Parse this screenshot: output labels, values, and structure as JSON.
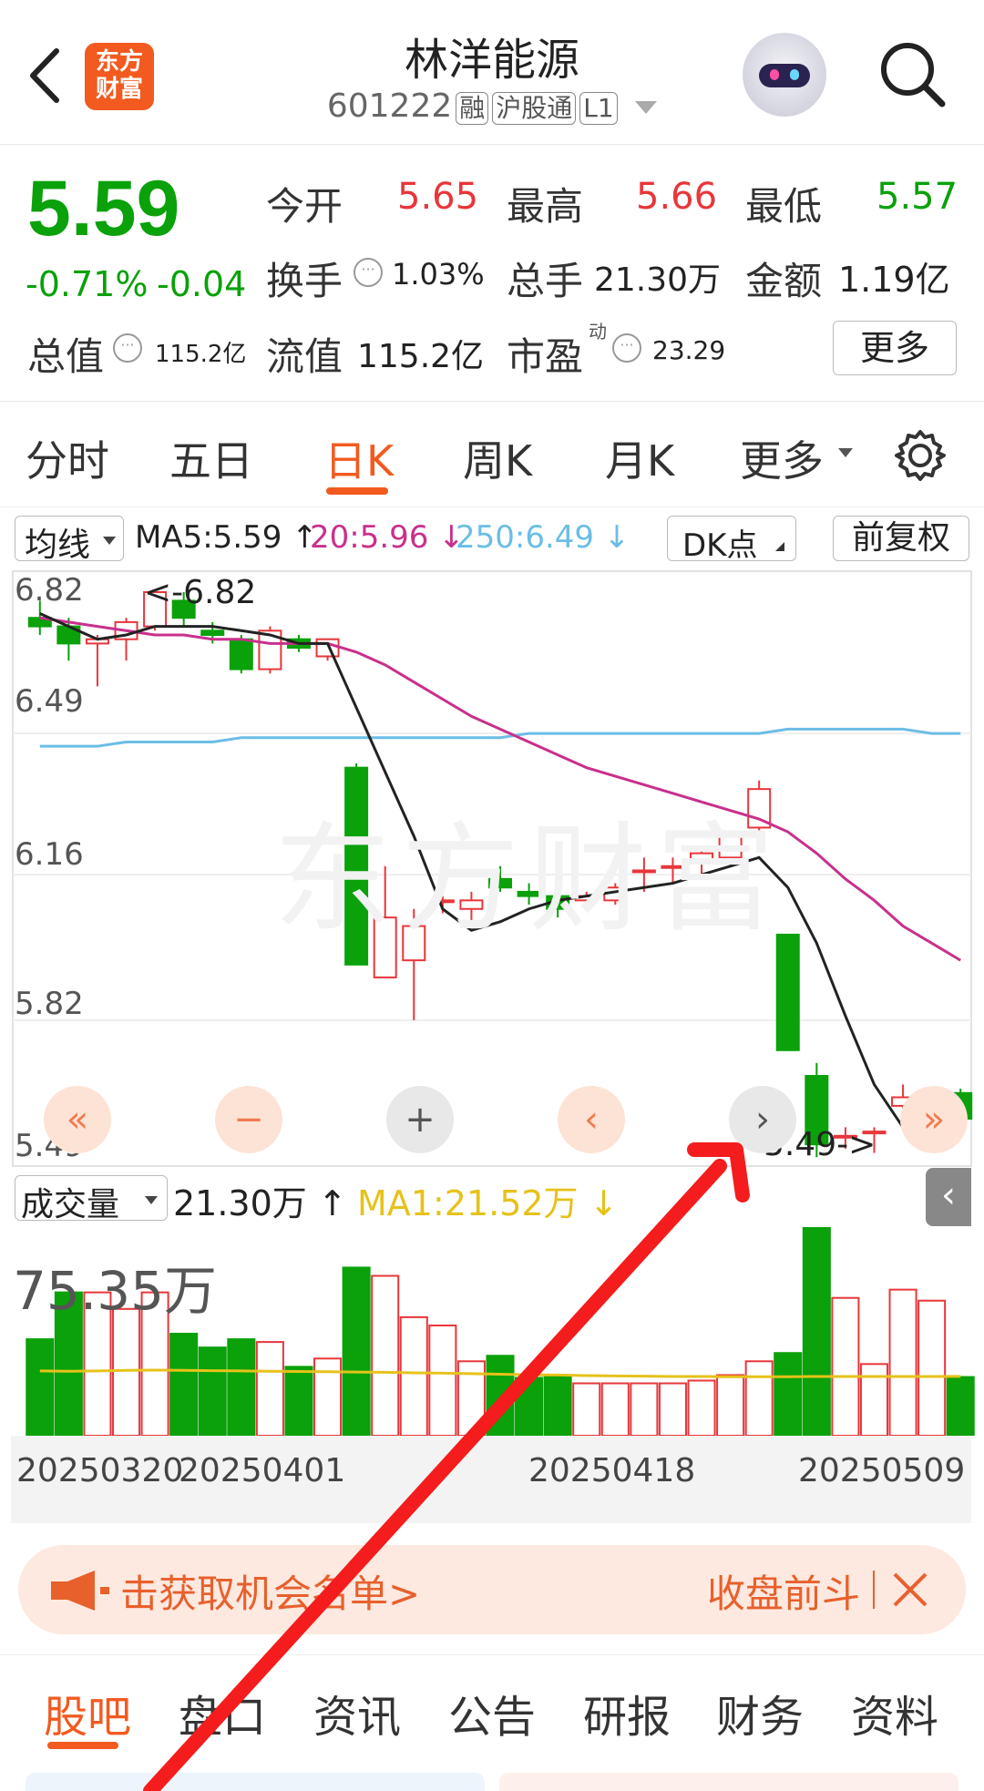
{
  "header": {
    "title": "林洋能源",
    "code": "601222",
    "tags": [
      "融",
      "沪股通",
      "L1"
    ],
    "logo_text": "东方财富"
  },
  "quote": {
    "price": "5.59",
    "change_pct": "-0.71%",
    "change": "-0.04",
    "open_label": "今开",
    "open": "5.65",
    "high_label": "最高",
    "high": "5.66",
    "low_label": "最低",
    "low": "5.57",
    "turnover_label": "换手",
    "turnover": "1.03%",
    "volume_label": "总手",
    "volume": "21.30万",
    "amount_label": "金额",
    "amount": "1.19亿",
    "mktcap_label": "总值",
    "mktcap": "115.2亿",
    "float_label": "流值",
    "float_cap": "115.2亿",
    "pe_label": "市盈",
    "pe_sup": "动",
    "pe": "23.29",
    "more_label": "更多"
  },
  "period_tabs": [
    "分时",
    "五日",
    "日K",
    "周K",
    "月K",
    "更多"
  ],
  "active_tab": "日K",
  "indicator_bar": {
    "selector": "均线",
    "ma5": "MA5:5.59",
    "ma20": "20:5.96",
    "ma250": "250:6.49",
    "dk": "DK点",
    "adjust": "前复权"
  },
  "price_axis": [
    "6.82",
    "6.49",
    "6.16",
    "5.82",
    "5.49"
  ],
  "annotations": {
    "high_marker": "<-6.82",
    "low_marker": "5.49->"
  },
  "volume_bar": {
    "selector": "成交量",
    "value": "21.30万",
    "ma1": "MA1:21.52万",
    "max_label": "75.35万"
  },
  "date_axis": [
    "20250320",
    "20250401",
    "20250418",
    "20250509"
  ],
  "banner": {
    "text": "击获取机会名单>",
    "right_text": "收盘前斗"
  },
  "bottom_tabs": [
    "股吧",
    "盘口",
    "资讯",
    "公告",
    "研报",
    "财务",
    "资料"
  ],
  "colors": {
    "up": "#e8363a",
    "down": "#0aa10a",
    "accent": "#f25a20",
    "ma5": "#222222",
    "ma20": "#c8308c",
    "ma250": "#6bbde6",
    "vol_ma": "#e6c21a"
  },
  "chart_data": {
    "type": "candlestick",
    "ylim": [
      5.49,
      6.82
    ],
    "candles": [
      {
        "o": 6.76,
        "h": 6.8,
        "l": 6.72,
        "c": 6.74
      },
      {
        "o": 6.74,
        "h": 6.76,
        "l": 6.66,
        "c": 6.7
      },
      {
        "o": 6.7,
        "h": 6.72,
        "l": 6.6,
        "c": 6.71
      },
      {
        "o": 6.71,
        "h": 6.76,
        "l": 6.66,
        "c": 6.75
      },
      {
        "o": 6.74,
        "h": 6.82,
        "l": 6.73,
        "c": 6.82
      },
      {
        "o": 6.8,
        "h": 6.82,
        "l": 6.74,
        "c": 6.76
      },
      {
        "o": 6.73,
        "h": 6.75,
        "l": 6.7,
        "c": 6.72
      },
      {
        "o": 6.71,
        "h": 6.72,
        "l": 6.63,
        "c": 6.64
      },
      {
        "o": 6.64,
        "h": 6.74,
        "l": 6.63,
        "c": 6.73
      },
      {
        "o": 6.71,
        "h": 6.72,
        "l": 6.68,
        "c": 6.69
      },
      {
        "o": 6.67,
        "h": 6.71,
        "l": 6.66,
        "c": 6.71
      },
      {
        "o": 6.41,
        "h": 6.42,
        "l": 5.95,
        "c": 5.95
      },
      {
        "o": 5.92,
        "h": 6.18,
        "l": 5.92,
        "c": 6.06
      },
      {
        "o": 5.96,
        "h": 6.08,
        "l": 5.82,
        "c": 6.04
      },
      {
        "o": 6.1,
        "h": 6.11,
        "l": 6.07,
        "c": 6.1
      },
      {
        "o": 6.08,
        "h": 6.12,
        "l": 6.05,
        "c": 6.1
      },
      {
        "o": 6.15,
        "h": 6.18,
        "l": 6.12,
        "c": 6.13
      },
      {
        "o": 6.12,
        "h": 6.14,
        "l": 6.09,
        "c": 6.11
      },
      {
        "o": 6.11,
        "h": 6.12,
        "l": 6.06,
        "c": 6.08
      },
      {
        "o": 6.1,
        "h": 6.12,
        "l": 6.08,
        "c": 6.11
      },
      {
        "o": 6.1,
        "h": 6.14,
        "l": 6.09,
        "c": 6.13
      },
      {
        "o": 6.17,
        "h": 6.2,
        "l": 6.12,
        "c": 6.17
      },
      {
        "o": 6.18,
        "h": 6.2,
        "l": 6.14,
        "c": 6.18
      },
      {
        "o": 6.19,
        "h": 6.22,
        "l": 6.16,
        "c": 6.21
      },
      {
        "o": 6.2,
        "h": 6.25,
        "l": 6.18,
        "c": 6.25
      },
      {
        "o": 6.27,
        "h": 6.38,
        "l": 6.26,
        "c": 6.36
      },
      {
        "o": 6.02,
        "h": 6.02,
        "l": 5.75,
        "c": 5.75
      },
      {
        "o": 5.69,
        "h": 5.72,
        "l": 5.5,
        "c": 5.53
      },
      {
        "o": 5.55,
        "h": 5.57,
        "l": 5.52,
        "c": 5.55
      },
      {
        "o": 5.56,
        "h": 5.57,
        "l": 5.51,
        "c": 5.56
      },
      {
        "o": 5.62,
        "h": 5.67,
        "l": 5.61,
        "c": 5.64
      },
      {
        "o": 5.63,
        "h": 5.66,
        "l": 5.58,
        "c": 5.65
      },
      {
        "o": 5.65,
        "h": 5.66,
        "l": 5.57,
        "c": 5.59
      }
    ],
    "ma5": [
      6.77,
      6.74,
      6.71,
      6.72,
      6.74,
      6.74,
      6.74,
      6.73,
      6.72,
      6.7,
      6.7,
      6.55,
      6.4,
      6.25,
      6.08,
      6.03,
      6.05,
      6.08,
      6.1,
      6.11,
      6.12,
      6.13,
      6.14,
      6.16,
      6.18,
      6.2,
      6.13,
      6.0,
      5.83,
      5.67,
      5.57,
      5.56,
      5.57
    ],
    "ma20": [
      6.76,
      6.75,
      6.74,
      6.73,
      6.72,
      6.72,
      6.71,
      6.71,
      6.7,
      6.7,
      6.7,
      6.68,
      6.65,
      6.61,
      6.57,
      6.53,
      6.5,
      6.47,
      6.44,
      6.41,
      6.39,
      6.37,
      6.35,
      6.33,
      6.31,
      6.29,
      6.26,
      6.21,
      6.15,
      6.1,
      6.04,
      6.0,
      5.96
    ],
    "ma250": [
      6.46,
      6.46,
      6.46,
      6.47,
      6.47,
      6.47,
      6.47,
      6.48,
      6.48,
      6.48,
      6.48,
      6.48,
      6.48,
      6.48,
      6.48,
      6.48,
      6.48,
      6.49,
      6.49,
      6.49,
      6.49,
      6.49,
      6.49,
      6.49,
      6.49,
      6.49,
      6.5,
      6.5,
      6.5,
      6.5,
      6.5,
      6.49,
      6.49
    ],
    "volume": [
      35,
      52,
      52,
      46,
      52,
      37,
      32,
      35,
      34,
      25,
      28,
      61,
      58,
      43,
      40,
      27,
      29,
      21,
      22,
      19,
      19,
      19,
      19,
      20,
      22,
      27,
      30,
      75.35,
      50,
      26,
      53,
      49,
      21.3
    ],
    "vol_ma": [
      23.5,
      23.4,
      23.5,
      23.7,
      23.8,
      23.7,
      23.6,
      23.5,
      23.4,
      23.3,
      23.2,
      23.1,
      23.0,
      22.8,
      22.7,
      22.5,
      22.3,
      22.1,
      22.0,
      21.8,
      21.7,
      21.6,
      21.5,
      21.5,
      21.4,
      21.4,
      21.4,
      21.5,
      21.5,
      21.5,
      21.5,
      21.5,
      21.52
    ],
    "vol_max": 75.35
  }
}
